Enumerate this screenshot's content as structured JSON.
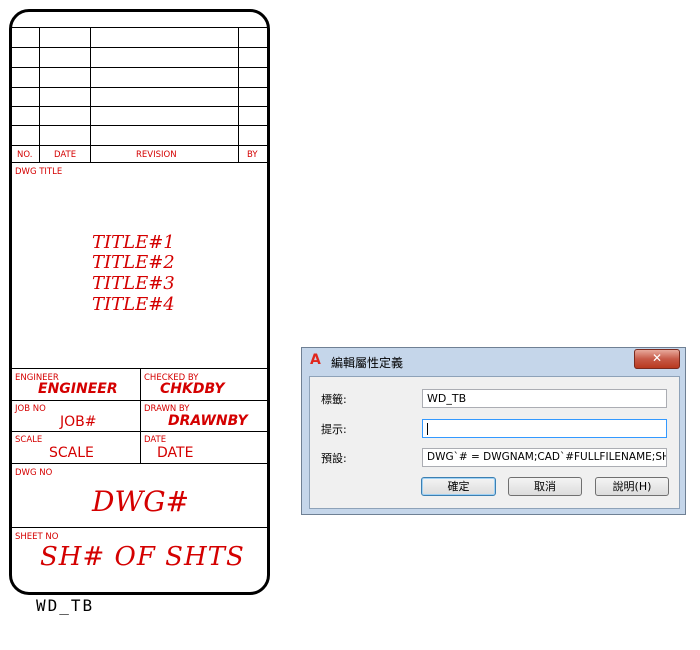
{
  "title_block": {
    "revision_header": {
      "no": "NO.",
      "date": "DATE",
      "revision": "REVISION",
      "by": "BY"
    },
    "dwg_title_label": "DWG TITLE",
    "titles": [
      "TITLE#1",
      "TITLE#2",
      "TITLE#3",
      "TITLE#4"
    ],
    "engineer_label": "ENGINEER",
    "engineer_value": "ENGINEER",
    "checked_by_label": "CHECKED BY",
    "checked_by_value": "CHKDBY",
    "job_no_label": "JOB NO",
    "job_no_value": "JOB#",
    "drawn_by_label": "DRAWN BY",
    "drawn_by_value": "DRAWNBY",
    "scale_label": "SCALE",
    "scale_value": "SCALE",
    "date_label": "DATE",
    "date_value": "DATE",
    "dwg_no_label": "DWG NO",
    "dwg_no_value": "DWG#",
    "sheet_no_label": "SHEET NO",
    "sheet_no_value": "SH# OF SHTS",
    "block_name": "WD_TB",
    "text_color": "#d40000"
  },
  "dialog": {
    "app_icon": "A",
    "title": "編輯屬性定義",
    "close_glyph": "✕",
    "tag_label": "標籤:",
    "tag_value": "WD_TB",
    "prompt_label": "提示:",
    "prompt_value": "",
    "default_label": "預設:",
    "default_value": "DWG`# = DWGNAM;CAD`#FULLFILENAME;SH",
    "ok_label": "確定",
    "cancel_label": "取消",
    "help_label": "說明(H)"
  }
}
